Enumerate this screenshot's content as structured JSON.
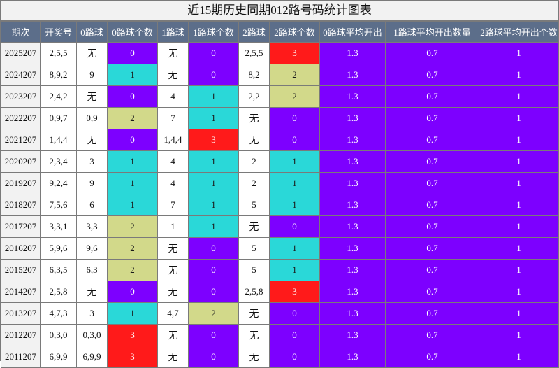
{
  "title": "近15期历史同期012路号码统计图表",
  "headers": [
    "期次",
    "开奖号",
    "0路球",
    "0路球个数",
    "1路球",
    "1路球个数",
    "2路球",
    "2路球个数",
    "0路球平均开出",
    "1路球平均开出数量",
    "2路球平均开出个数"
  ],
  "colors": {
    "header_bg": "#5c6e8a",
    "count_0": "#7d00ff",
    "count_1": "#2ad8d8",
    "count_2": "#d2d98a",
    "count_3": "#ff1a1a",
    "avg_bg": "#7d00ff"
  },
  "rows": [
    {
      "period": "2025207",
      "draw": "2,5,5",
      "r0": "无",
      "c0": 0,
      "r1": "无",
      "c1": 0,
      "r2": "2,5,5",
      "c2": 3,
      "a0": "1.3",
      "a1": "0.7",
      "a2": "1"
    },
    {
      "period": "2024207",
      "draw": "8,9,2",
      "r0": "9",
      "c0": 1,
      "r1": "无",
      "c1": 0,
      "r2": "8,2",
      "c2": 2,
      "a0": "1.3",
      "a1": "0.7",
      "a2": "1"
    },
    {
      "period": "2023207",
      "draw": "2,4,2",
      "r0": "无",
      "c0": 0,
      "r1": "4",
      "c1": 1,
      "r2": "2,2",
      "c2": 2,
      "a0": "1.3",
      "a1": "0.7",
      "a2": "1"
    },
    {
      "period": "2022207",
      "draw": "0,9,7",
      "r0": "0,9",
      "c0": 2,
      "r1": "7",
      "c1": 1,
      "r2": "无",
      "c2": 0,
      "a0": "1.3",
      "a1": "0.7",
      "a2": "1"
    },
    {
      "period": "2021207",
      "draw": "1,4,4",
      "r0": "无",
      "c0": 0,
      "r1": "1,4,4",
      "c1": 3,
      "r2": "无",
      "c2": 0,
      "a0": "1.3",
      "a1": "0.7",
      "a2": "1"
    },
    {
      "period": "2020207",
      "draw": "2,3,4",
      "r0": "3",
      "c0": 1,
      "r1": "4",
      "c1": 1,
      "r2": "2",
      "c2": 1,
      "a0": "1.3",
      "a1": "0.7",
      "a2": "1"
    },
    {
      "period": "2019207",
      "draw": "9,2,4",
      "r0": "9",
      "c0": 1,
      "r1": "4",
      "c1": 1,
      "r2": "2",
      "c2": 1,
      "a0": "1.3",
      "a1": "0.7",
      "a2": "1"
    },
    {
      "period": "2018207",
      "draw": "7,5,6",
      "r0": "6",
      "c0": 1,
      "r1": "7",
      "c1": 1,
      "r2": "5",
      "c2": 1,
      "a0": "1.3",
      "a1": "0.7",
      "a2": "1"
    },
    {
      "period": "2017207",
      "draw": "3,3,1",
      "r0": "3,3",
      "c0": 2,
      "r1": "1",
      "c1": 1,
      "r2": "无",
      "c2": 0,
      "a0": "1.3",
      "a1": "0.7",
      "a2": "1"
    },
    {
      "period": "2016207",
      "draw": "5,9,6",
      "r0": "9,6",
      "c0": 2,
      "r1": "无",
      "c1": 0,
      "r2": "5",
      "c2": 1,
      "a0": "1.3",
      "a1": "0.7",
      "a2": "1"
    },
    {
      "period": "2015207",
      "draw": "6,3,5",
      "r0": "6,3",
      "c0": 2,
      "r1": "无",
      "c1": 0,
      "r2": "5",
      "c2": 1,
      "a0": "1.3",
      "a1": "0.7",
      "a2": "1"
    },
    {
      "period": "2014207",
      "draw": "2,5,8",
      "r0": "无",
      "c0": 0,
      "r1": "无",
      "c1": 0,
      "r2": "2,5,8",
      "c2": 3,
      "a0": "1.3",
      "a1": "0.7",
      "a2": "1"
    },
    {
      "period": "2013207",
      "draw": "4,7,3",
      "r0": "3",
      "c0": 1,
      "r1": "4,7",
      "c1": 2,
      "r2": "无",
      "c2": 0,
      "a0": "1.3",
      "a1": "0.7",
      "a2": "1"
    },
    {
      "period": "2012207",
      "draw": "0,3,0",
      "r0": "0,3,0",
      "c0": 3,
      "r1": "无",
      "c1": 0,
      "r2": "无",
      "c2": 0,
      "a0": "1.3",
      "a1": "0.7",
      "a2": "1"
    },
    {
      "period": "2011207",
      "draw": "6,9,9",
      "r0": "6,9,9",
      "c0": 3,
      "r1": "无",
      "c1": 0,
      "r2": "无",
      "c2": 0,
      "a0": "1.3",
      "a1": "0.7",
      "a2": "1"
    }
  ]
}
